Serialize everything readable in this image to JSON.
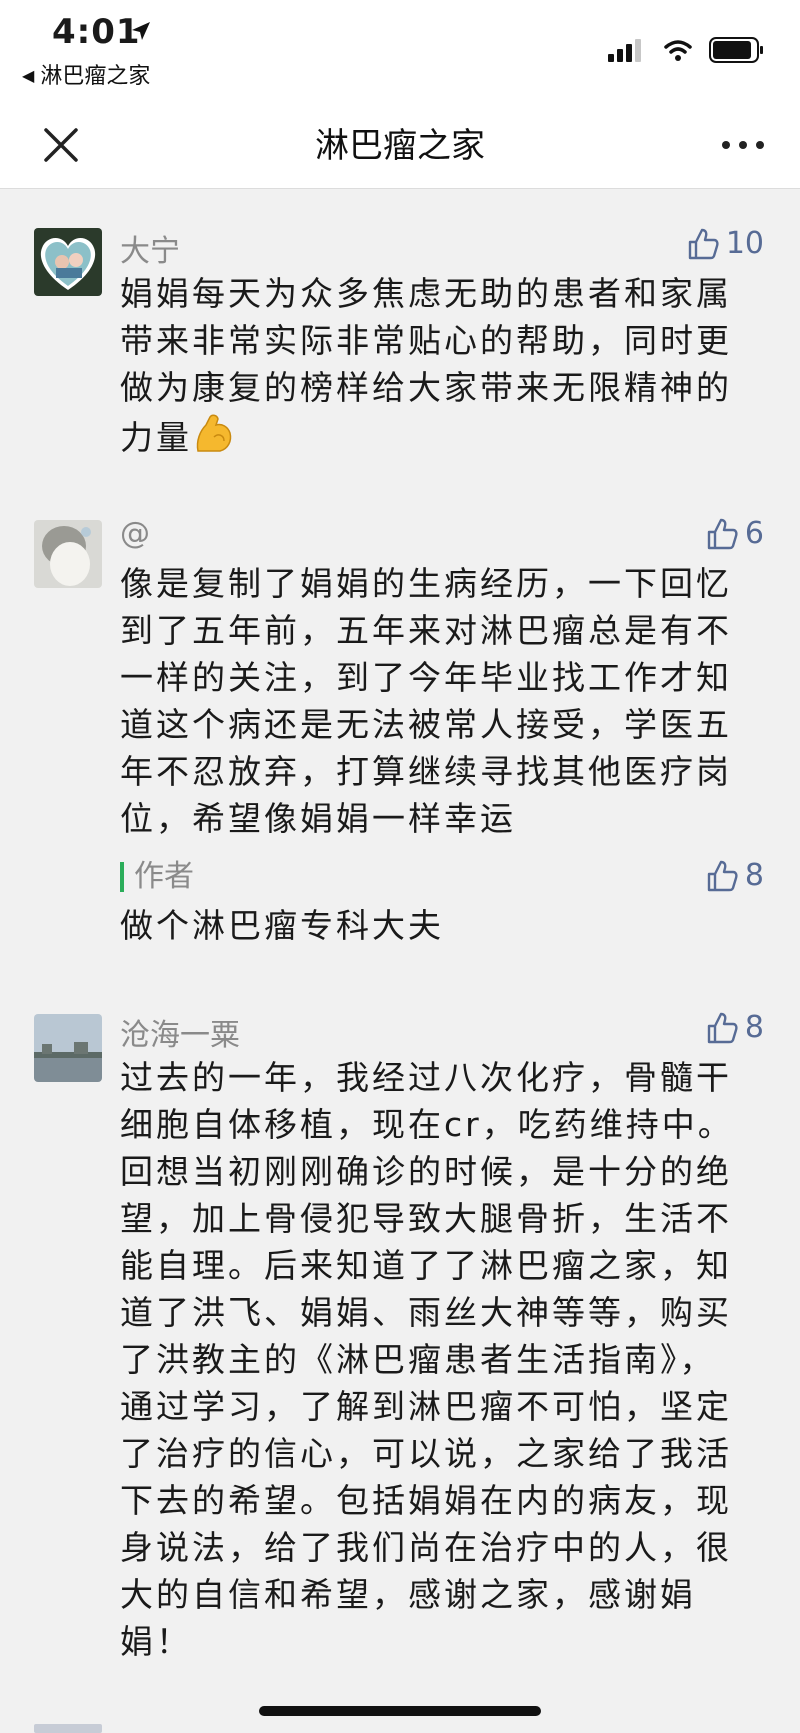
{
  "status_bar": {
    "time": "4:01",
    "back_app_label": "淋巴瘤之家"
  },
  "nav": {
    "title": "淋巴瘤之家"
  },
  "comments": [
    {
      "name": "大宁",
      "likes": "10",
      "text": "娟娟每天为众多焦虑无助的患者和家属带来非常实际非常贴心的帮助，同时更做为康复的榜样给大家带来无限精神的力量"
    },
    {
      "name": "@",
      "likes": "6",
      "text": "像是复制了娟娟的生病经历，一下回忆到了五年前，五年来对淋巴瘤总是有不一样的关注，到了今年毕业找工作才知道这个病还是无法被常人接受，学医五年不忍放弃，打算继续寻找其他医疗岗位，希望像娟娟一样幸运",
      "reply": {
        "label": "作者",
        "likes": "8",
        "text": "做个淋巴瘤专科大夫"
      }
    },
    {
      "name": "沧海一粟",
      "likes": "8",
      "text": "过去的一年，我经过八次化疗，骨髓干细胞自体移植，现在cr，吃药维持中。回想当初刚刚确诊的时候，是十分的绝望，加上骨侵犯导致大腿骨折，生活不能自理。后来知道了了淋巴瘤之家，知道了洪飞、娟娟、雨丝大神等等，购买了洪教主的《淋巴瘤患者生活指南》，通过学习，了解到淋巴瘤不可怕，坚定了治疗的信心，可以说，之家给了我活下去的希望。包括娟娟在内的病友，现身说法，给了我们尚在治疗中的人，很大的自信和希望，感谢之家，感谢娟娟！"
    }
  ],
  "icons": {
    "like": "thumbs-up-icon",
    "close": "close-icon",
    "more": "more-dots-icon",
    "emoji": "flexed-biceps-icon"
  },
  "colors": {
    "like": "#576b95",
    "reply_bar": "#2bad5a",
    "name": "#8a8a8a"
  }
}
